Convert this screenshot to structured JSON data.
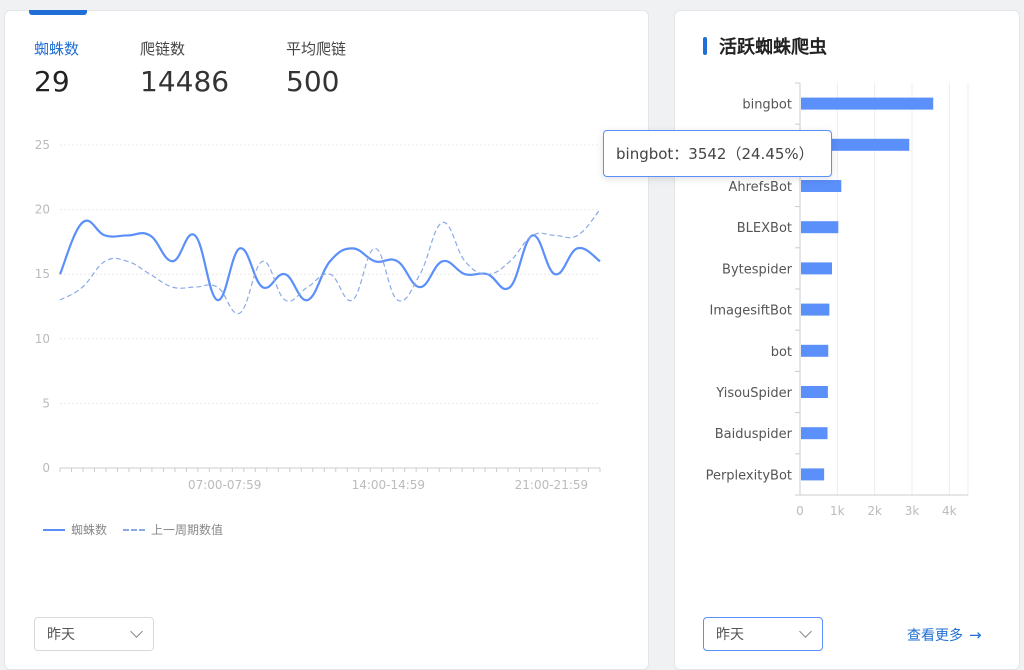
{
  "left_panel": {
    "stats": [
      {
        "label": "蜘蛛数",
        "value": "29",
        "active": true
      },
      {
        "label": "爬链数",
        "value": "14486",
        "active": false
      },
      {
        "label": "平均爬链",
        "value": "500",
        "active": false
      }
    ],
    "legend": {
      "current": "蜘蛛数",
      "previous": "上一周期数值"
    },
    "period_select": "昨天"
  },
  "right_panel": {
    "title": "活跃蜘蛛爬虫",
    "period_select": "昨天",
    "more_link": "查看更多",
    "tooltip": "bingbot：3542（24.45%）"
  },
  "colors": {
    "accent": "#1f6fd6",
    "series": "#5b8ff9",
    "series_prev": "#8ba9e6"
  },
  "chart_data": [
    {
      "type": "line",
      "x_ticks": [
        "07:00-07:59",
        "14:00-14:59",
        "21:00-21:59"
      ],
      "ylim": [
        0,
        25
      ],
      "y_ticks": [
        0,
        5,
        10,
        15,
        20,
        25
      ],
      "series": [
        {
          "name": "蜘蛛数",
          "style": "solid",
          "values": [
            15,
            19,
            18,
            18,
            18,
            16,
            18,
            13,
            17,
            14,
            15,
            13,
            16,
            17,
            16,
            16,
            14,
            16,
            15,
            15,
            14,
            18,
            15,
            17,
            16
          ]
        },
        {
          "name": "上一周期数值",
          "style": "dashed",
          "values": [
            13,
            14,
            16,
            16,
            15,
            14,
            14,
            14,
            12,
            16,
            13,
            14,
            15,
            13,
            17,
            13,
            15,
            19,
            16,
            15,
            16,
            18,
            18,
            18,
            20
          ]
        }
      ],
      "grid": true
    },
    {
      "type": "bar",
      "orientation": "horizontal",
      "categories": [
        "bingbot",
        "",
        "AhrefsBot",
        "BLEXBot",
        "Bytespider",
        "ImagesiftBot",
        "bot",
        "YisouSpider",
        "Baiduspider",
        "PerplexityBot"
      ],
      "values": [
        3542,
        2900,
        1080,
        1000,
        830,
        760,
        730,
        720,
        710,
        620
      ],
      "x_ticks": [
        "0",
        "1k",
        "2k",
        "3k",
        "4k"
      ],
      "xlim": [
        0,
        4500
      ],
      "grid": true
    }
  ]
}
